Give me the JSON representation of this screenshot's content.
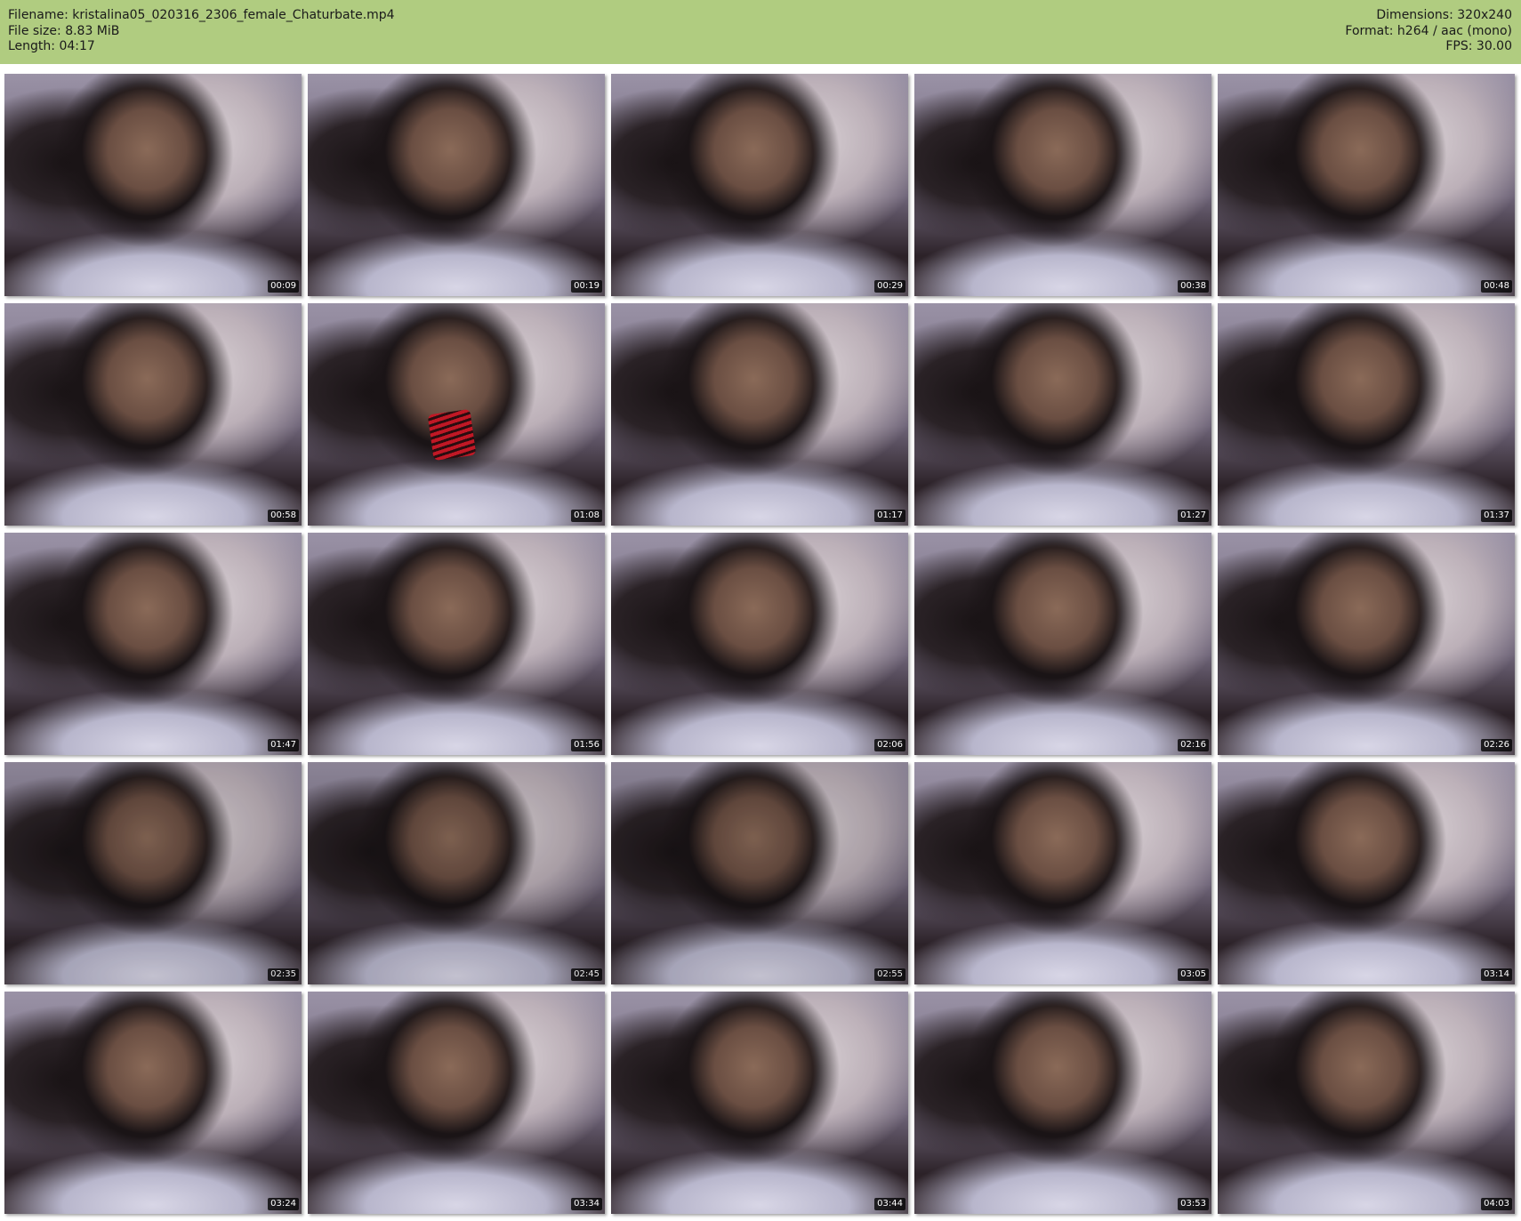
{
  "info": {
    "filename": "Filename: kristalina05_020316_2306_female_Chaturbate.mp4",
    "file_size": "File size: 8.83 MiB",
    "length": "Length: 04:17",
    "dimensions": "Dimensions: 320x240",
    "format": "Format: h264 / aac (mono)",
    "fps": "FPS: 30.00"
  },
  "colors": {
    "header_bg": "#b0cc80",
    "page_bg": "#ffffff",
    "timestamp_bg": "#000000",
    "timestamp_text": "#ffffff"
  },
  "thumbnails": [
    {
      "time": "00:09"
    },
    {
      "time": "00:19"
    },
    {
      "time": "00:29"
    },
    {
      "time": "00:38"
    },
    {
      "time": "00:48"
    },
    {
      "time": "00:58"
    },
    {
      "time": "01:08"
    },
    {
      "time": "01:17"
    },
    {
      "time": "01:27"
    },
    {
      "time": "01:37"
    },
    {
      "time": "01:47"
    },
    {
      "time": "01:56"
    },
    {
      "time": "02:06"
    },
    {
      "time": "02:16"
    },
    {
      "time": "02:26"
    },
    {
      "time": "02:35"
    },
    {
      "time": "02:45"
    },
    {
      "time": "02:55"
    },
    {
      "time": "03:05"
    },
    {
      "time": "03:14"
    },
    {
      "time": "03:24"
    },
    {
      "time": "03:34"
    },
    {
      "time": "03:44"
    },
    {
      "time": "03:53"
    },
    {
      "time": "04:03"
    }
  ]
}
